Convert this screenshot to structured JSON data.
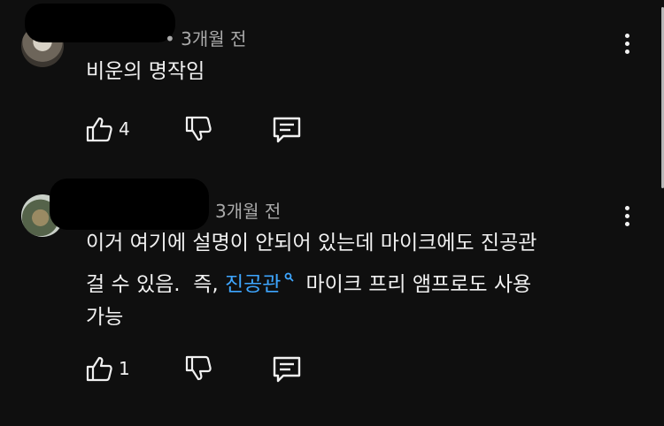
{
  "comments": [
    {
      "time": "3개월 전",
      "text": "비운의 명작임",
      "likes": "4"
    },
    {
      "time": "3개월 전",
      "line1": "이거 여기에 설명이 안되어 있는데 마이크에도 진공관",
      "line2_before": "걸 수 있음.  즉, ",
      "line2_link": "진공관",
      "line2_after": "마이크 프리 앰프로도 사용",
      "line3": "가능",
      "likes": "1"
    }
  ],
  "icons": {
    "like": "thumbs-up-icon",
    "dislike": "thumbs-down-icon",
    "reply": "reply-comment-icon",
    "more": "more-vert-icon",
    "search": "search-icon"
  },
  "colors": {
    "background": "#0f0f0f",
    "text": "#f1f1f1",
    "meta": "#aaaaaa",
    "link": "#3ea6ff"
  }
}
